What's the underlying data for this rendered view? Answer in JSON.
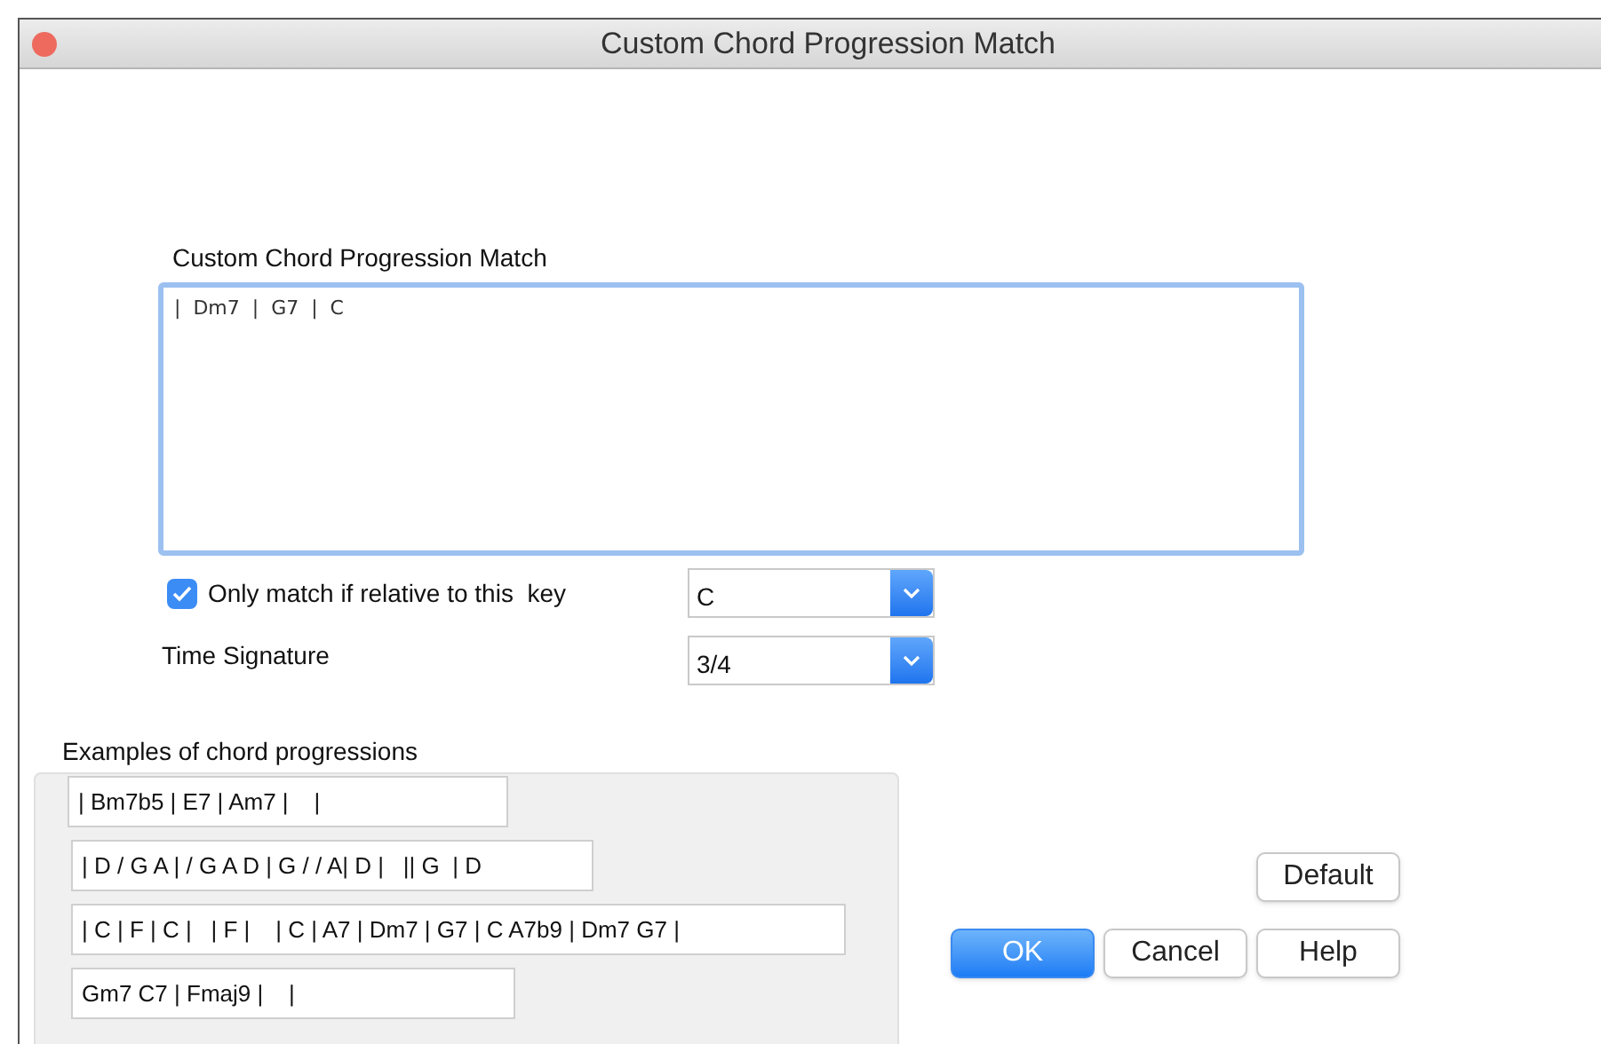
{
  "window": {
    "title": "Custom Chord Progression Match"
  },
  "progression": {
    "label": "Custom Chord Progression Match",
    "value": "|  Dm7  |  G7  |  C"
  },
  "key_option": {
    "label": "Only match if relative to this  key",
    "checked": true,
    "value": "C"
  },
  "time_signature": {
    "label": "Time Signature",
    "value": "3/4"
  },
  "examples": {
    "label": "Examples of chord progressions",
    "items": [
      "| Bm7b5 | E7 | Am7 |    |",
      "| D / G A | / G A D | G / / A| D |   || G  | D",
      "| C | F | C |   | F |    | C | A7 | Dm7 | G7 | C A7b9 | Dm7 G7 |",
      "Gm7 C7 | Fmaj9 |    |"
    ]
  },
  "buttons": [
    {
      "label": "Default",
      "kind": "plain"
    },
    {
      "label": "OK",
      "kind": "default"
    },
    {
      "label": "Cancel",
      "kind": "plain"
    },
    {
      "label": "Help",
      "kind": "plain"
    }
  ]
}
